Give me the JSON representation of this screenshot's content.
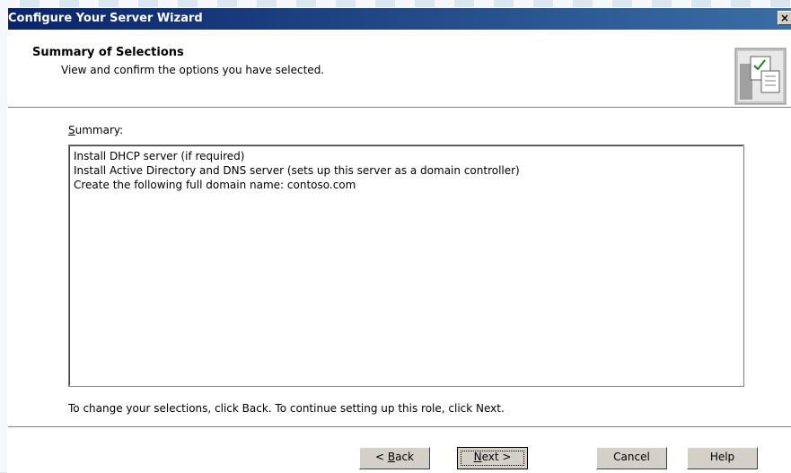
{
  "window": {
    "title": "Configure Your Server Wizard",
    "close_glyph": "×"
  },
  "header": {
    "title": "Summary of Selections",
    "subtitle": "View and confirm the options you have selected.",
    "icon": "wizard-checklist-icon"
  },
  "summary": {
    "label_underlined": "S",
    "label_rest": "ummary:",
    "lines": [
      "Install DHCP server (if required)",
      "Install Active Directory and DNS server (sets up this server as a domain controller)",
      "Create the following full domain name: contoso.com"
    ]
  },
  "hint": "To change your selections, click Back. To continue setting up this role, click Next.",
  "buttons": {
    "back_pre": "< ",
    "back_u": "B",
    "back_post": "ack",
    "next_u": "N",
    "next_post": "ext >",
    "cancel": "Cancel",
    "help": "Help"
  }
}
